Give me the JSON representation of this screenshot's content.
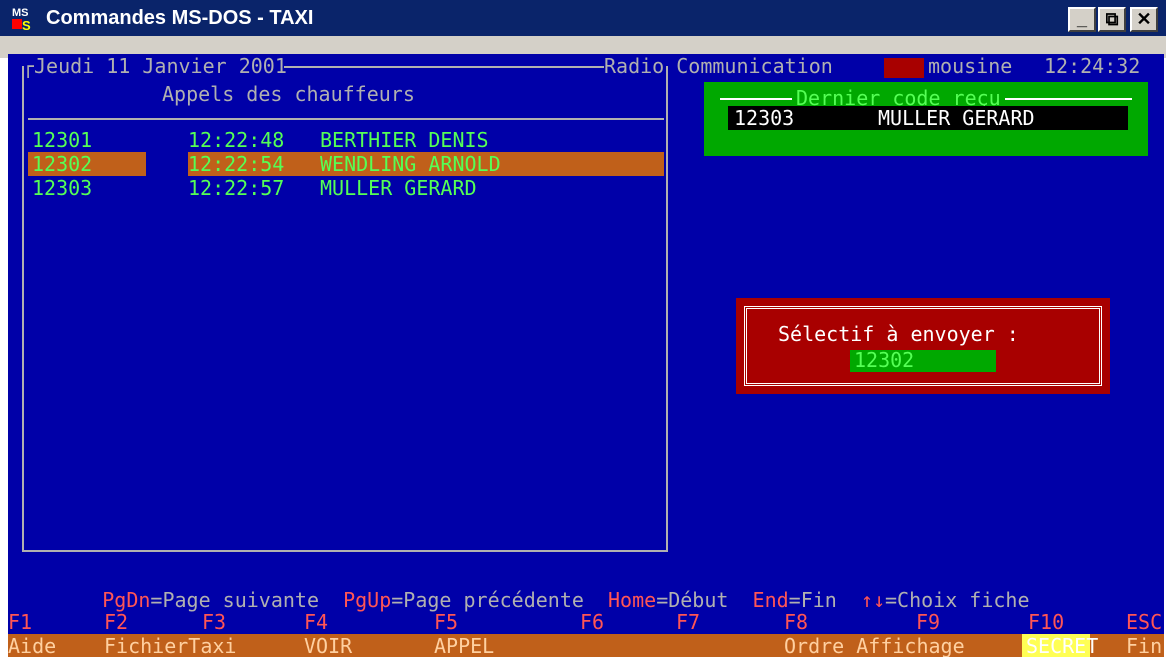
{
  "window": {
    "title": "Commandes MS-DOS - TAXI",
    "icon": "msdos-icon",
    "buttons": {
      "minimize": "_",
      "maximize": "⧉",
      "close": "✕"
    }
  },
  "header": {
    "date": "Jeudi 11 Janvier 2001",
    "radio_label": "Radio Communication",
    "limousine": "mousine",
    "time": "12:24:32"
  },
  "left_panel": {
    "title": "Appels des chauffeurs",
    "rows": [
      {
        "code": "12301",
        "time": "12:22:48",
        "name": "BERTHIER DENIS",
        "selected": false
      },
      {
        "code": "12302",
        "time": "12:22:54",
        "name": "WENDLING ARNOLD",
        "selected": true
      },
      {
        "code": "12303",
        "time": "12:22:57",
        "name": "MULLER GERARD",
        "selected": false
      }
    ]
  },
  "last_code": {
    "label": "Dernier code reçu",
    "code": "12303",
    "name": "MULLER GERARD"
  },
  "selective": {
    "label": "Sélectif à envoyer :",
    "value": "12302"
  },
  "help_line": {
    "pgdn_key": "PgDn",
    "pgdn_text": "=Page suivante",
    "pgup_key": "PgUp",
    "pgup_text": "=Page précédente",
    "home_key": "Home",
    "home_text": "=Début",
    "end_key": "End",
    "end_text": "=Fin",
    "arrows_key": "↑↓",
    "arrows_text": "=Choix fiche"
  },
  "function_keys": [
    {
      "key": "F1",
      "label": "Aide"
    },
    {
      "key": "F2",
      "label": "FichierTaxi"
    },
    {
      "key": "F3",
      "label": ""
    },
    {
      "key": "F4",
      "label": "VOIR"
    },
    {
      "key": "F5",
      "label": "APPEL"
    },
    {
      "key": "F6",
      "label": ""
    },
    {
      "key": "F7",
      "label": ""
    },
    {
      "key": "F8",
      "label": "Ordre Affichage"
    },
    {
      "key": "F9",
      "label": ""
    },
    {
      "key": "F10",
      "label": "SECRET"
    },
    {
      "key": "ESC",
      "label": "Fin"
    }
  ],
  "colors": {
    "console_bg": "#0000a8",
    "highlight": "#c0601a",
    "green": "#55ff55",
    "red": "#ff5555"
  }
}
